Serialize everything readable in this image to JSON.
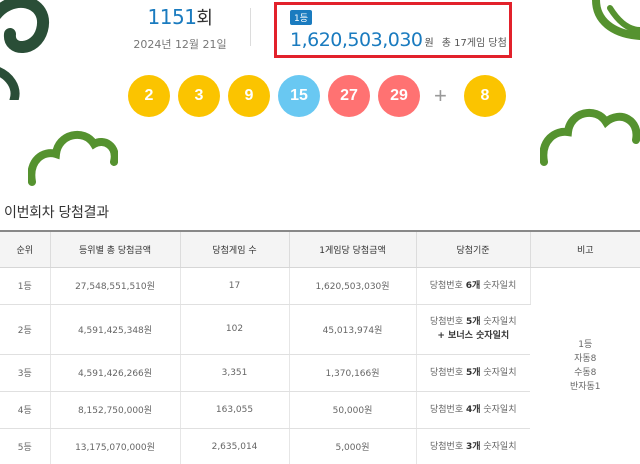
{
  "draw": {
    "round_number": "1151",
    "round_unit": "회",
    "date": "2024년 12월 21일"
  },
  "first_prize": {
    "badge": "1등",
    "amount": "1,620,503,030",
    "currency": "원",
    "winners_text": "총 17게임 당첨"
  },
  "balls": {
    "numbers": [
      {
        "value": "2",
        "color": "#fbc400"
      },
      {
        "value": "3",
        "color": "#fbc400"
      },
      {
        "value": "9",
        "color": "#fbc400"
      },
      {
        "value": "15",
        "color": "#69c8f2"
      },
      {
        "value": "27",
        "color": "#ff7272"
      },
      {
        "value": "29",
        "color": "#ff7272"
      }
    ],
    "plus": "+",
    "bonus": {
      "value": "8",
      "color": "#fbc400"
    }
  },
  "section_title": "이번회차 당첨결과",
  "table": {
    "headers": [
      "순위",
      "등위별 총 당첨금액",
      "당첨게임 수",
      "1게임당 당첨금액",
      "당첨기준",
      "비고"
    ],
    "rows": [
      {
        "rank": "1등",
        "total": "27,548,551,510원",
        "games": "17",
        "per_game": "1,620,503,030원",
        "crit_pre": "당첨번호 ",
        "crit_bold": "6개",
        "crit_post": " 숫자일치",
        "crit_line2": ""
      },
      {
        "rank": "2등",
        "total": "4,591,425,348원",
        "games": "102",
        "per_game": "45,013,974원",
        "crit_pre": "당첨번호 ",
        "crit_bold": "5개",
        "crit_post": " 숫자일치",
        "crit_line2": "+ 보너스 숫자일치"
      },
      {
        "rank": "3등",
        "total": "4,591,426,266원",
        "games": "3,351",
        "per_game": "1,370,166원",
        "crit_pre": "당첨번호 ",
        "crit_bold": "5개",
        "crit_post": " 숫자일치",
        "crit_line2": ""
      },
      {
        "rank": "4등",
        "total": "8,152,750,000원",
        "games": "163,055",
        "per_game": "50,000원",
        "crit_pre": "당첨번호 ",
        "crit_bold": "4개",
        "crit_post": " 숫자일치",
        "crit_line2": ""
      },
      {
        "rank": "5등",
        "total": "13,175,070,000원",
        "games": "2,635,014",
        "per_game": "5,000원",
        "crit_pre": "당첨번호 ",
        "crit_bold": "3개",
        "crit_post": " 숫자일치",
        "crit_line2": ""
      }
    ],
    "note": {
      "line1": "1등",
      "line2": "자동8",
      "line3": "수동8",
      "line4": "반자동1"
    }
  }
}
